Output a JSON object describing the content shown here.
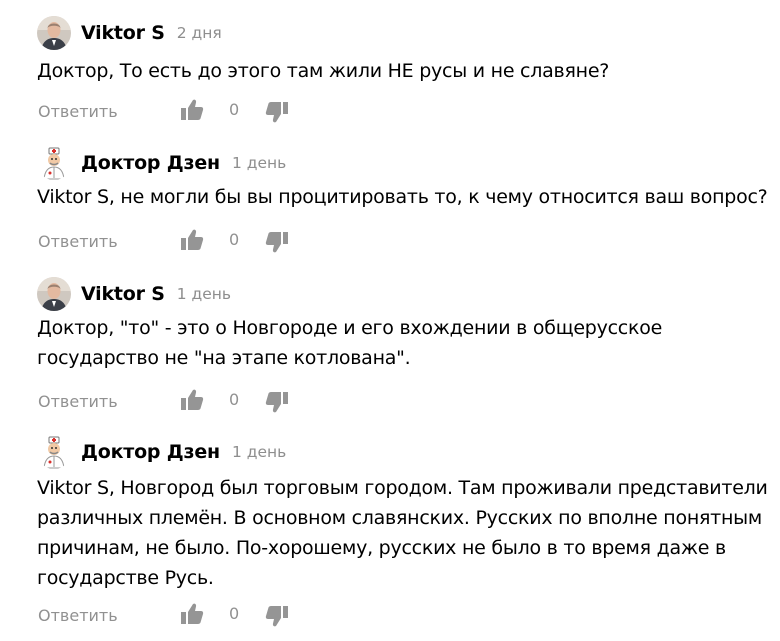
{
  "colors": {
    "text": "#000000",
    "muted": "#919191",
    "icon": "#959595"
  },
  "comments": [
    {
      "author": "Viktor S",
      "time": "2 дня",
      "avatar": "photo-avatar",
      "lines": [
        "Доктор, То есть до этого там жили НЕ русы и не славяне?"
      ],
      "reply_label": "Ответить",
      "likes": "0"
    },
    {
      "author": "Доктор Дзен",
      "time": "1 день",
      "avatar": "doctor-avatar",
      "lines": [
        "Viktor S, не могли бы вы процитировать то, к чему относится ваш вопрос?"
      ],
      "reply_label": "Ответить",
      "likes": "0"
    },
    {
      "author": "Viktor S",
      "time": "1 день",
      "avatar": "photo-avatar",
      "lines": [
        "Доктор, \"то\" - это о Новгороде и его вхождении в общерусское",
        "государство не \"на этапе котлована\"."
      ],
      "reply_label": "Ответить",
      "likes": "0"
    },
    {
      "author": "Доктор Дзен",
      "time": "1 день",
      "avatar": "doctor-avatar",
      "lines": [
        "Viktor S, Новгород был торговым городом. Там проживали представители",
        "различных племён. В основном славянских. Русских по вполне понятным",
        "причинам, не было. По-хорошему, русских не было в то время даже в",
        "государстве Русь."
      ],
      "reply_label": "Ответить",
      "likes": "0"
    }
  ]
}
